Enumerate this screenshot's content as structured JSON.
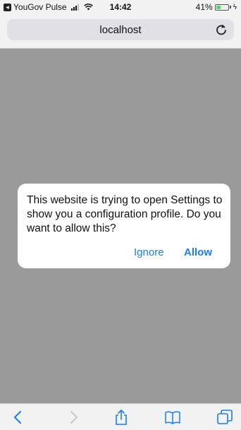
{
  "status_bar": {
    "app_name": "YouGov Pulse",
    "time": "14:42",
    "battery_percent_text": "41%",
    "battery_level": 0.41
  },
  "address_bar": {
    "url": "localhost"
  },
  "alert": {
    "message": "This website is trying to open Settings to show you a configuration profile. Do you want to allow this?",
    "ignore_label": "Ignore",
    "allow_label": "Allow"
  },
  "toolbar": {
    "icons": [
      "back-icon",
      "forward-icon",
      "share-icon",
      "bookmarks-icon",
      "tabs-icon"
    ]
  },
  "colors": {
    "accent": "#1a7cf5",
    "overlay": "#9a9a9a"
  }
}
